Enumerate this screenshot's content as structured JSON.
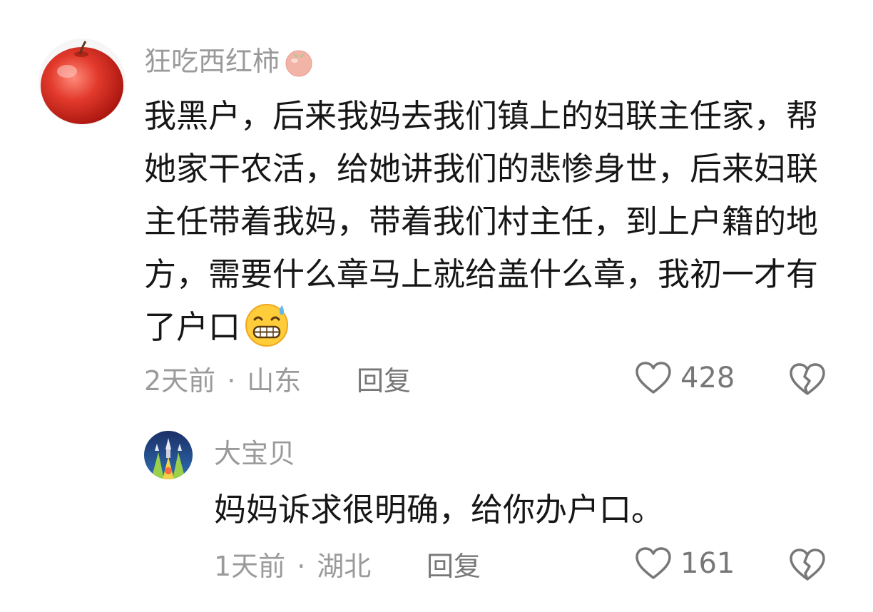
{
  "comments": [
    {
      "username": "狂吃西红柿",
      "username_badge_icon": "tomato-icon",
      "avatar_icon": "red-apple-avatar",
      "text": "我黑户，后来我妈去我们镇上的妇联主任家，帮她家干农活，给她讲我们的悲惨身世，后来妇联主任带着我妈，带着我们村主任，到上户籍的地方，需要什么章马上就给盖什么章，我初一才有了户口",
      "trailing_emoji": "grinning-sweat-emoji",
      "time": "2天前",
      "separator": "·",
      "location": "山东",
      "reply_label": "回复",
      "like_count": "428",
      "like_icon": "heart-outline-icon",
      "dislike_icon": "broken-heart-icon"
    },
    {
      "username": "大宝贝",
      "avatar_icon": "rocket-launch-avatar",
      "text": "妈妈诉求很明确，给你办户口。",
      "time": "1天前",
      "separator": "·",
      "location": "湖北",
      "reply_label": "回复",
      "like_count": "161",
      "like_icon": "heart-outline-icon",
      "dislike_icon": "broken-heart-icon"
    }
  ],
  "colors": {
    "meta_text": "#9a9a9a",
    "action_text": "#777777",
    "body_text": "#161616",
    "background": "#ffffff"
  }
}
